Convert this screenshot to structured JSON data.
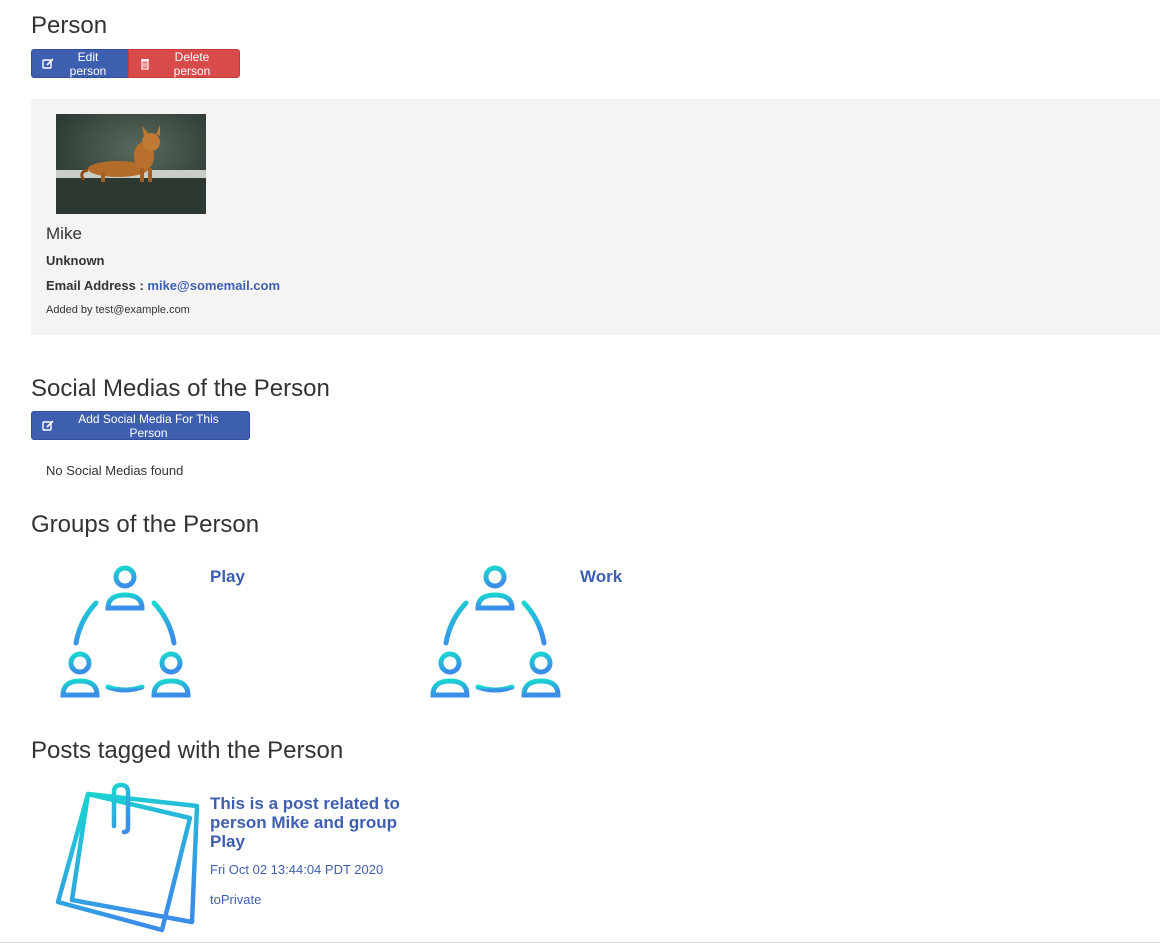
{
  "page": {
    "title": "Person"
  },
  "actions": {
    "edit_label": "Edit person",
    "delete_label": "Delete person"
  },
  "person": {
    "name": "Mike",
    "gender": "Unknown",
    "email_label": "Email Address :",
    "email": "mike@somemail.com",
    "added_by": "Added by test@example.com"
  },
  "social": {
    "heading": "Social Medias of the Person",
    "add_label": "Add Social Media For This Person",
    "empty_text": "No Social Medias found"
  },
  "groups": {
    "heading": "Groups of the Person",
    "items": [
      {
        "name": "Play"
      },
      {
        "name": "Work"
      }
    ]
  },
  "posts": {
    "heading": "Posts tagged with the Person",
    "items": [
      {
        "title": "This is a post related to person Mike and group Play",
        "date": "Fri Oct 02 13:44:04 PDT 2020",
        "visibility": "toPrivate"
      }
    ]
  },
  "colors": {
    "primary": "#3e5fb0",
    "danger": "#d94b4b",
    "icon_gradient_start": "#17d9cf",
    "icon_gradient_end": "#3a8ee8"
  }
}
